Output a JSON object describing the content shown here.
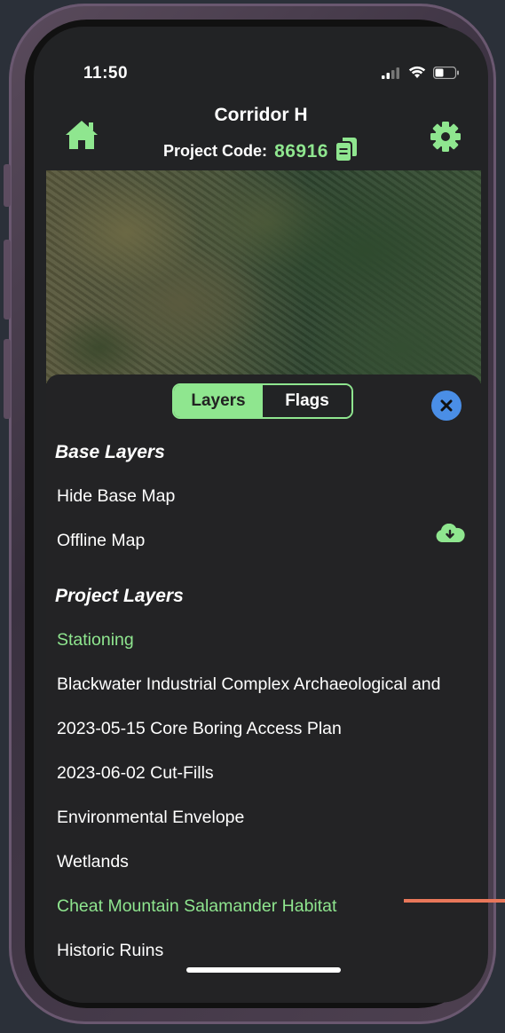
{
  "status": {
    "time": "11:50"
  },
  "header": {
    "title": "Corridor H",
    "code_label": "Project Code:",
    "code_value": "86916"
  },
  "tabs": {
    "layers": "Layers",
    "flags": "Flags"
  },
  "base_layers": {
    "heading": "Base Layers",
    "items": [
      {
        "label": "Hide Base Map"
      },
      {
        "label": "Offline Map"
      }
    ]
  },
  "project_layers": {
    "heading": "Project Layers",
    "items": [
      {
        "label": "Stationing",
        "active": true
      },
      {
        "label": "Blackwater Industrial Complex Archaeological and",
        "active": false
      },
      {
        "label": "2023-05-15 Core Boring Access Plan",
        "active": false
      },
      {
        "label": "2023-06-02 Cut-Fills",
        "active": false
      },
      {
        "label": "Environmental Envelope",
        "active": false
      },
      {
        "label": "Wetlands",
        "active": false
      },
      {
        "label": "Cheat Mountain Salamander Habitat",
        "active": true
      },
      {
        "label": "Historic Ruins",
        "active": false
      }
    ]
  },
  "colors": {
    "accent": "#8fe68f",
    "close": "#4a8ee6",
    "background": "#232325"
  },
  "icons": {
    "home": "home-icon",
    "settings": "gear-icon",
    "copy": "copy-icon",
    "close": "close-icon",
    "download": "cloud-download-icon"
  }
}
